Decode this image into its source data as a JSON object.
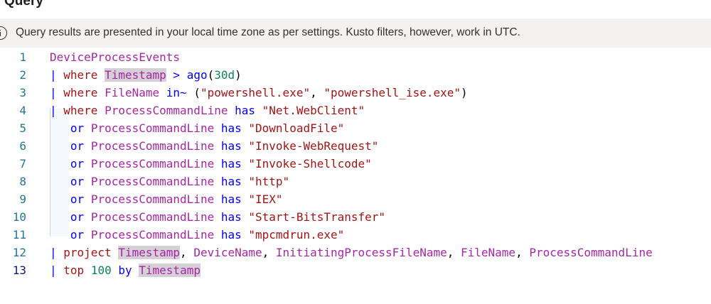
{
  "header": {
    "title": "Query"
  },
  "banner": {
    "icon": "info-icon",
    "text": "Query results are presented in your local time zone as per settings. Kusto filters, however, work in UTC."
  },
  "editor": {
    "lines": [
      {
        "num": "1",
        "tokens": [
          {
            "t": "DeviceProcessEvents",
            "c": "tbl"
          }
        ]
      },
      {
        "num": "2",
        "tokens": [
          {
            "t": "| ",
            "c": "pipe"
          },
          {
            "t": "where",
            "c": "kw"
          },
          {
            "t": " ",
            "c": "plain"
          },
          {
            "t": "Timestamp",
            "c": "col hl"
          },
          {
            "t": " ",
            "c": "plain"
          },
          {
            "t": ">",
            "c": "op"
          },
          {
            "t": " ",
            "c": "plain"
          },
          {
            "t": "ago",
            "c": "fn"
          },
          {
            "t": "(",
            "c": "plain"
          },
          {
            "t": "30d",
            "c": "num"
          },
          {
            "t": ")",
            "c": "plain"
          }
        ]
      },
      {
        "num": "3",
        "tokens": [
          {
            "t": "| ",
            "c": "pipe"
          },
          {
            "t": "where",
            "c": "kw"
          },
          {
            "t": " ",
            "c": "plain"
          },
          {
            "t": "FileName",
            "c": "col"
          },
          {
            "t": " ",
            "c": "plain"
          },
          {
            "t": "in~",
            "c": "op"
          },
          {
            "t": " (",
            "c": "plain"
          },
          {
            "t": "\"powershell.exe\"",
            "c": "str"
          },
          {
            "t": ", ",
            "c": "plain"
          },
          {
            "t": "\"powershell_ise.exe\"",
            "c": "str"
          },
          {
            "t": ")",
            "c": "plain"
          }
        ]
      },
      {
        "num": "4",
        "tokens": [
          {
            "t": "| ",
            "c": "pipe"
          },
          {
            "t": "where",
            "c": "kw"
          },
          {
            "t": " ",
            "c": "plain"
          },
          {
            "t": "ProcessCommandLine",
            "c": "col"
          },
          {
            "t": " ",
            "c": "plain"
          },
          {
            "t": "has",
            "c": "op"
          },
          {
            "t": " ",
            "c": "plain"
          },
          {
            "t": "\"Net.WebClient\"",
            "c": "str"
          }
        ]
      },
      {
        "num": "5",
        "tokens": [
          {
            "t": "   ",
            "c": "plain"
          },
          {
            "t": "or",
            "c": "op"
          },
          {
            "t": " ",
            "c": "plain"
          },
          {
            "t": "ProcessCommandLine",
            "c": "col"
          },
          {
            "t": " ",
            "c": "plain"
          },
          {
            "t": "has",
            "c": "op"
          },
          {
            "t": " ",
            "c": "plain"
          },
          {
            "t": "\"DownloadFile\"",
            "c": "str"
          }
        ]
      },
      {
        "num": "6",
        "tokens": [
          {
            "t": "   ",
            "c": "plain"
          },
          {
            "t": "or",
            "c": "op"
          },
          {
            "t": " ",
            "c": "plain"
          },
          {
            "t": "ProcessCommandLine",
            "c": "col"
          },
          {
            "t": " ",
            "c": "plain"
          },
          {
            "t": "has",
            "c": "op"
          },
          {
            "t": " ",
            "c": "plain"
          },
          {
            "t": "\"Invoke-WebRequest\"",
            "c": "str"
          }
        ]
      },
      {
        "num": "7",
        "tokens": [
          {
            "t": "   ",
            "c": "plain"
          },
          {
            "t": "or",
            "c": "op"
          },
          {
            "t": " ",
            "c": "plain"
          },
          {
            "t": "ProcessCommandLine",
            "c": "col"
          },
          {
            "t": " ",
            "c": "plain"
          },
          {
            "t": "has",
            "c": "op"
          },
          {
            "t": " ",
            "c": "plain"
          },
          {
            "t": "\"Invoke-Shellcode\"",
            "c": "str"
          }
        ]
      },
      {
        "num": "8",
        "tokens": [
          {
            "t": "   ",
            "c": "plain"
          },
          {
            "t": "or",
            "c": "op"
          },
          {
            "t": " ",
            "c": "plain"
          },
          {
            "t": "ProcessCommandLine",
            "c": "col"
          },
          {
            "t": " ",
            "c": "plain"
          },
          {
            "t": "has",
            "c": "op"
          },
          {
            "t": " ",
            "c": "plain"
          },
          {
            "t": "\"http\"",
            "c": "str"
          }
        ]
      },
      {
        "num": "9",
        "tokens": [
          {
            "t": "   ",
            "c": "plain"
          },
          {
            "t": "or",
            "c": "op"
          },
          {
            "t": " ",
            "c": "plain"
          },
          {
            "t": "ProcessCommandLine",
            "c": "col"
          },
          {
            "t": " ",
            "c": "plain"
          },
          {
            "t": "has",
            "c": "op"
          },
          {
            "t": " ",
            "c": "plain"
          },
          {
            "t": "\"IEX\"",
            "c": "str"
          }
        ]
      },
      {
        "num": "10",
        "tokens": [
          {
            "t": "   ",
            "c": "plain"
          },
          {
            "t": "or",
            "c": "op"
          },
          {
            "t": " ",
            "c": "plain"
          },
          {
            "t": "ProcessCommandLine",
            "c": "col"
          },
          {
            "t": " ",
            "c": "plain"
          },
          {
            "t": "has",
            "c": "op"
          },
          {
            "t": " ",
            "c": "plain"
          },
          {
            "t": "\"Start-BitsTransfer\"",
            "c": "str"
          }
        ]
      },
      {
        "num": "11",
        "tokens": [
          {
            "t": "   ",
            "c": "plain"
          },
          {
            "t": "or",
            "c": "op"
          },
          {
            "t": " ",
            "c": "plain"
          },
          {
            "t": "ProcessCommandLine",
            "c": "col"
          },
          {
            "t": " ",
            "c": "plain"
          },
          {
            "t": "has",
            "c": "op"
          },
          {
            "t": " ",
            "c": "plain"
          },
          {
            "t": "\"mpcmdrun.exe\"",
            "c": "str"
          }
        ]
      },
      {
        "num": "12",
        "tokens": [
          {
            "t": "| ",
            "c": "pipe"
          },
          {
            "t": "project",
            "c": "kw"
          },
          {
            "t": " ",
            "c": "plain"
          },
          {
            "t": "Timestamp",
            "c": "col hl"
          },
          {
            "t": ", ",
            "c": "plain"
          },
          {
            "t": "DeviceName",
            "c": "col"
          },
          {
            "t": ", ",
            "c": "plain"
          },
          {
            "t": "InitiatingProcessFileName",
            "c": "col"
          },
          {
            "t": ", ",
            "c": "plain"
          },
          {
            "t": "FileName",
            "c": "col"
          },
          {
            "t": ", ",
            "c": "plain"
          },
          {
            "t": "ProcessCommandLine",
            "c": "col"
          }
        ]
      },
      {
        "num": "13",
        "active": true,
        "tokens": [
          {
            "t": "| ",
            "c": "pipe"
          },
          {
            "t": "top",
            "c": "kw"
          },
          {
            "t": " ",
            "c": "plain"
          },
          {
            "t": "100",
            "c": "num"
          },
          {
            "t": " ",
            "c": "plain"
          },
          {
            "t": "by",
            "c": "op"
          },
          {
            "t": " ",
            "c": "plain"
          },
          {
            "t": "Timestamp",
            "c": "col hl"
          }
        ]
      }
    ]
  }
}
